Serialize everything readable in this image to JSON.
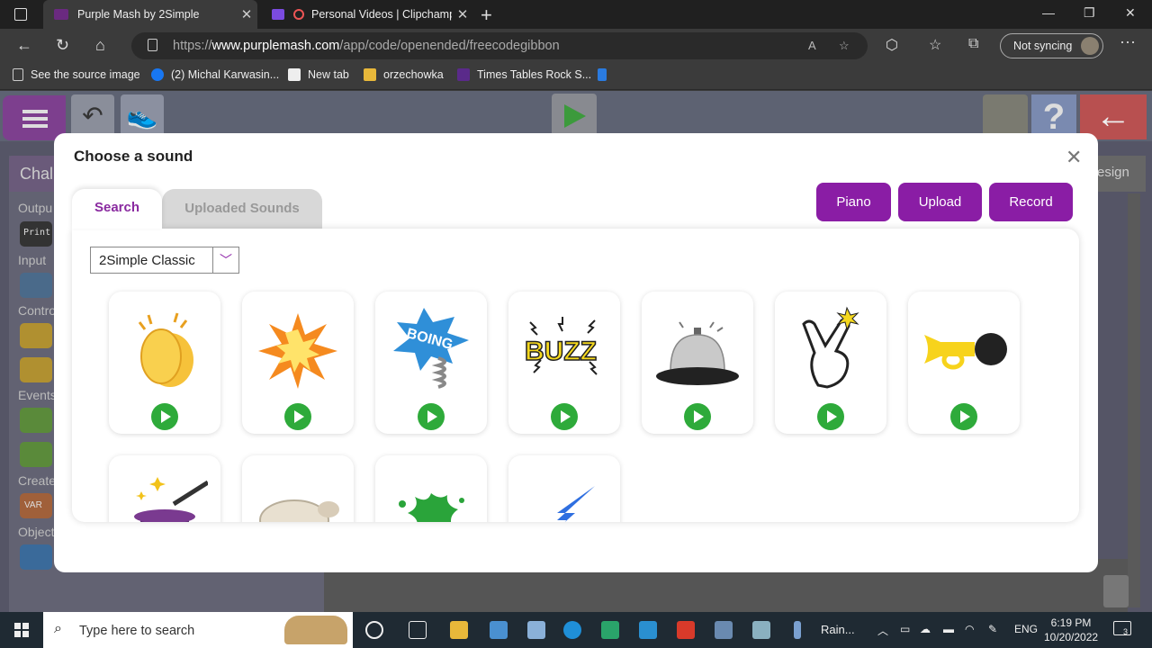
{
  "browser": {
    "tabs": [
      {
        "title": "Purple Mash by 2Simple"
      },
      {
        "title": "Personal Videos | Clipchamp"
      }
    ],
    "url_prefix": "https://",
    "url_host": "www.purplemash.com",
    "url_path": "/app/code/openended/freecodegibbon",
    "sync_label": "Not syncing",
    "bookmarks": [
      {
        "label": "See the source image"
      },
      {
        "label": "(2) Michal Karwasin..."
      },
      {
        "label": "New tab"
      },
      {
        "label": "orzechowka"
      },
      {
        "label": "Times Tables Rock S..."
      }
    ]
  },
  "app": {
    "challenge_tab": "Chal",
    "design_tab": "esign",
    "categories": [
      "Outpu",
      "Input",
      "Contro",
      "Events",
      "Create",
      "Object"
    ],
    "print_block": "Print",
    "var_block": "VAR"
  },
  "modal": {
    "title": "Choose a sound",
    "tabs": {
      "search": "Search",
      "uploaded": "Uploaded Sounds"
    },
    "buttons": {
      "piano": "Piano",
      "upload": "Upload",
      "record": "Record"
    },
    "library_select": "2Simple Classic",
    "sound_icons": [
      "clapping-hands",
      "explosion",
      "boing",
      "buzz",
      "service-bell",
      "finger-snap",
      "horn",
      "magic-hat",
      "sheep",
      "splat",
      "lightning"
    ]
  },
  "taskbar": {
    "search_placeholder": "Type here to search",
    "weather": "Rain...",
    "lang": "ENG",
    "time": "6:19 PM",
    "date": "10/20/2022",
    "notif_count": "3"
  },
  "colors": {
    "accent": "#8a1da5",
    "play_green": "#2eaa3a"
  }
}
